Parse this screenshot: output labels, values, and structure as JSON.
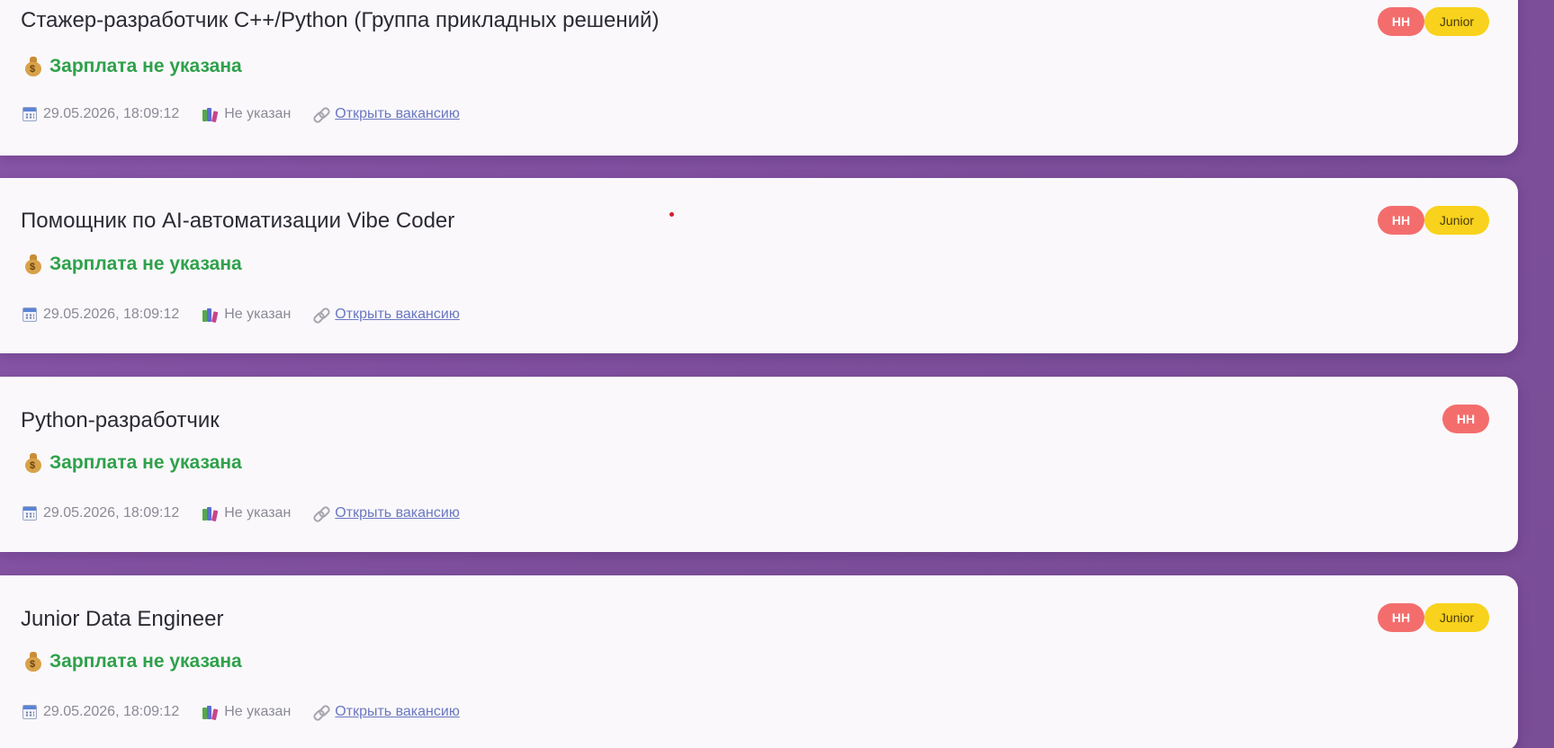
{
  "vacancies": [
    {
      "title": "Стажер-разработчик C++/Python (Группа прикладных решений)",
      "badges": [
        "HH",
        "Junior"
      ],
      "salary": "Зарплата не указана",
      "date": "29.05.2026, 18:09:12",
      "experience": "Не указан",
      "link_label": "Открыть вакансию"
    },
    {
      "title": "Помощник по AI-автоматизации Vibe Coder",
      "badges": [
        "HH",
        "Junior"
      ],
      "salary": "Зарплата не указана",
      "date": "29.05.2026, 18:09:12",
      "experience": "Не указан",
      "link_label": "Открыть вакансию"
    },
    {
      "title": "Python-разработчик",
      "badges": [
        "HH"
      ],
      "salary": "Зарплата не указана",
      "date": "29.05.2026, 18:09:12",
      "experience": "Не указан",
      "link_label": "Открыть вакансию"
    },
    {
      "title": "Junior Data Engineer",
      "badges": [
        "HH",
        "Junior"
      ],
      "salary": "Зарплата не указана",
      "date": "29.05.2026, 18:09:12",
      "experience": "Не указан",
      "link_label": "Открыть вакансию"
    }
  ],
  "icons": {
    "salary": "moneybag-icon",
    "date": "calendar-icon",
    "experience": "books-icon",
    "link": "link-icon"
  },
  "colors": {
    "background": "#7d4f9c",
    "card": "#faf8fb",
    "salary_text": "#2fa14b",
    "badge_hh": "#f46d6d",
    "badge_junior": "#f8d21c",
    "link": "#6a78c0"
  }
}
